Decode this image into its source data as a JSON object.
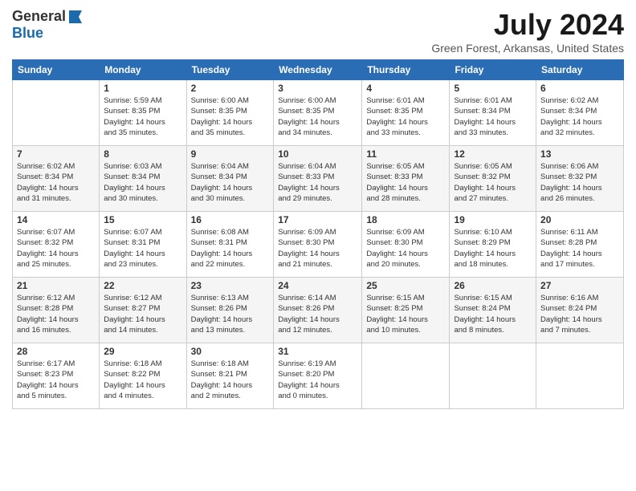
{
  "logo": {
    "general": "General",
    "blue": "Blue"
  },
  "title": "July 2024",
  "location": "Green Forest, Arkansas, United States",
  "weekdays": [
    "Sunday",
    "Monday",
    "Tuesday",
    "Wednesday",
    "Thursday",
    "Friday",
    "Saturday"
  ],
  "weeks": [
    [
      {
        "day": "",
        "info": ""
      },
      {
        "day": "1",
        "info": "Sunrise: 5:59 AM\nSunset: 8:35 PM\nDaylight: 14 hours\nand 35 minutes."
      },
      {
        "day": "2",
        "info": "Sunrise: 6:00 AM\nSunset: 8:35 PM\nDaylight: 14 hours\nand 35 minutes."
      },
      {
        "day": "3",
        "info": "Sunrise: 6:00 AM\nSunset: 8:35 PM\nDaylight: 14 hours\nand 34 minutes."
      },
      {
        "day": "4",
        "info": "Sunrise: 6:01 AM\nSunset: 8:35 PM\nDaylight: 14 hours\nand 33 minutes."
      },
      {
        "day": "5",
        "info": "Sunrise: 6:01 AM\nSunset: 8:34 PM\nDaylight: 14 hours\nand 33 minutes."
      },
      {
        "day": "6",
        "info": "Sunrise: 6:02 AM\nSunset: 8:34 PM\nDaylight: 14 hours\nand 32 minutes."
      }
    ],
    [
      {
        "day": "7",
        "info": "Sunrise: 6:02 AM\nSunset: 8:34 PM\nDaylight: 14 hours\nand 31 minutes."
      },
      {
        "day": "8",
        "info": "Sunrise: 6:03 AM\nSunset: 8:34 PM\nDaylight: 14 hours\nand 30 minutes."
      },
      {
        "day": "9",
        "info": "Sunrise: 6:04 AM\nSunset: 8:34 PM\nDaylight: 14 hours\nand 30 minutes."
      },
      {
        "day": "10",
        "info": "Sunrise: 6:04 AM\nSunset: 8:33 PM\nDaylight: 14 hours\nand 29 minutes."
      },
      {
        "day": "11",
        "info": "Sunrise: 6:05 AM\nSunset: 8:33 PM\nDaylight: 14 hours\nand 28 minutes."
      },
      {
        "day": "12",
        "info": "Sunrise: 6:05 AM\nSunset: 8:32 PM\nDaylight: 14 hours\nand 27 minutes."
      },
      {
        "day": "13",
        "info": "Sunrise: 6:06 AM\nSunset: 8:32 PM\nDaylight: 14 hours\nand 26 minutes."
      }
    ],
    [
      {
        "day": "14",
        "info": "Sunrise: 6:07 AM\nSunset: 8:32 PM\nDaylight: 14 hours\nand 25 minutes."
      },
      {
        "day": "15",
        "info": "Sunrise: 6:07 AM\nSunset: 8:31 PM\nDaylight: 14 hours\nand 23 minutes."
      },
      {
        "day": "16",
        "info": "Sunrise: 6:08 AM\nSunset: 8:31 PM\nDaylight: 14 hours\nand 22 minutes."
      },
      {
        "day": "17",
        "info": "Sunrise: 6:09 AM\nSunset: 8:30 PM\nDaylight: 14 hours\nand 21 minutes."
      },
      {
        "day": "18",
        "info": "Sunrise: 6:09 AM\nSunset: 8:30 PM\nDaylight: 14 hours\nand 20 minutes."
      },
      {
        "day": "19",
        "info": "Sunrise: 6:10 AM\nSunset: 8:29 PM\nDaylight: 14 hours\nand 18 minutes."
      },
      {
        "day": "20",
        "info": "Sunrise: 6:11 AM\nSunset: 8:28 PM\nDaylight: 14 hours\nand 17 minutes."
      }
    ],
    [
      {
        "day": "21",
        "info": "Sunrise: 6:12 AM\nSunset: 8:28 PM\nDaylight: 14 hours\nand 16 minutes."
      },
      {
        "day": "22",
        "info": "Sunrise: 6:12 AM\nSunset: 8:27 PM\nDaylight: 14 hours\nand 14 minutes."
      },
      {
        "day": "23",
        "info": "Sunrise: 6:13 AM\nSunset: 8:26 PM\nDaylight: 14 hours\nand 13 minutes."
      },
      {
        "day": "24",
        "info": "Sunrise: 6:14 AM\nSunset: 8:26 PM\nDaylight: 14 hours\nand 12 minutes."
      },
      {
        "day": "25",
        "info": "Sunrise: 6:15 AM\nSunset: 8:25 PM\nDaylight: 14 hours\nand 10 minutes."
      },
      {
        "day": "26",
        "info": "Sunrise: 6:15 AM\nSunset: 8:24 PM\nDaylight: 14 hours\nand 8 minutes."
      },
      {
        "day": "27",
        "info": "Sunrise: 6:16 AM\nSunset: 8:24 PM\nDaylight: 14 hours\nand 7 minutes."
      }
    ],
    [
      {
        "day": "28",
        "info": "Sunrise: 6:17 AM\nSunset: 8:23 PM\nDaylight: 14 hours\nand 5 minutes."
      },
      {
        "day": "29",
        "info": "Sunrise: 6:18 AM\nSunset: 8:22 PM\nDaylight: 14 hours\nand 4 minutes."
      },
      {
        "day": "30",
        "info": "Sunrise: 6:18 AM\nSunset: 8:21 PM\nDaylight: 14 hours\nand 2 minutes."
      },
      {
        "day": "31",
        "info": "Sunrise: 6:19 AM\nSunset: 8:20 PM\nDaylight: 14 hours\nand 0 minutes."
      },
      {
        "day": "",
        "info": ""
      },
      {
        "day": "",
        "info": ""
      },
      {
        "day": "",
        "info": ""
      }
    ]
  ]
}
